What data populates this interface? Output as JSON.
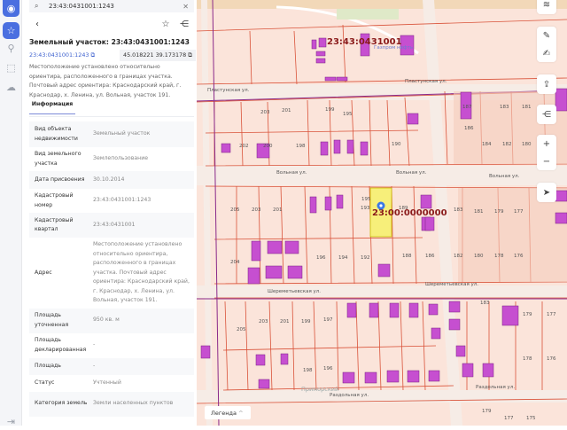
{
  "search": {
    "value": "23:43:0431001:1243"
  },
  "panel": {
    "title": "Земельный участок: 23:43:0431001:1243",
    "cad_number": "23:43:0431001:1243",
    "coords": "45.018221 39.173178",
    "description": "Местоположение установлено относительно ориентира, расположенного в границах участка. Почтовый адрес ориентира: Краснодарский край, г. Краснодар, х. Ленина, ул. Вольная, участок 191.",
    "tab": "Информация",
    "rows": [
      {
        "k": "Вид объекта недвижимости",
        "v": "Земельный участок"
      },
      {
        "k": "Вид земельного участка",
        "v": "Землепользование"
      },
      {
        "k": "Дата присвоения",
        "v": "30.10.2014"
      },
      {
        "k": "Кадастровый номер",
        "v": "23:43:0431001:1243"
      },
      {
        "k": "Кадастровый квартал",
        "v": "23:43:0431001"
      },
      {
        "k": "Адрес",
        "v": "Местоположение установлено относительно ориентира, расположенного в границах участка. Почтовый адрес ориентира: Краснодарский край, г. Краснодар, х. Ленина, ул. Вольная, участок 191."
      },
      {
        "k": "Площадь уточненная",
        "v": "950 кв. м"
      },
      {
        "k": "Площадь декларированная",
        "v": "-"
      },
      {
        "k": "Площадь",
        "v": "-"
      },
      {
        "k": "Статус",
        "v": "Учтенный"
      },
      {
        "k": "Категория земель",
        "v": "Земли населенных пунктов"
      }
    ]
  },
  "map": {
    "quarter_label": "23:43:0431001",
    "zero_label": "23:00:0000000",
    "streets": {
      "plastunskaya": "Пластунская ул.",
      "volnaya": "Вольная ул.",
      "sheremetyevskaya": "Шереметьевская ул.",
      "razdolnaya": "Раздольная ул.",
      "primorskiy": "Приморский"
    },
    "poi": "Газпром нефть",
    "parcels": [
      "203",
      "201",
      "199",
      "197",
      "195",
      "187",
      "206",
      "204",
      "202",
      "200",
      "198",
      "190",
      "188",
      "186",
      "184",
      "182",
      "180",
      "178",
      "183",
      "181",
      "179",
      "205",
      "203",
      "201",
      "195",
      "193",
      "189",
      "204",
      "196",
      "194",
      "192",
      "190",
      "188",
      "186",
      "183",
      "181",
      "179",
      "177",
      "182",
      "180",
      "178",
      "176",
      "205",
      "203",
      "201",
      "199",
      "197",
      "198",
      "196",
      "183",
      "179",
      "177",
      "178",
      "176",
      "181",
      "179",
      "177",
      "175"
    ],
    "legend": "Легенда"
  },
  "colors": {
    "accent": "#3b5fce",
    "parcel_line": "#d9533a",
    "building": "#c64fd0",
    "selected": "#f7ef7a"
  }
}
